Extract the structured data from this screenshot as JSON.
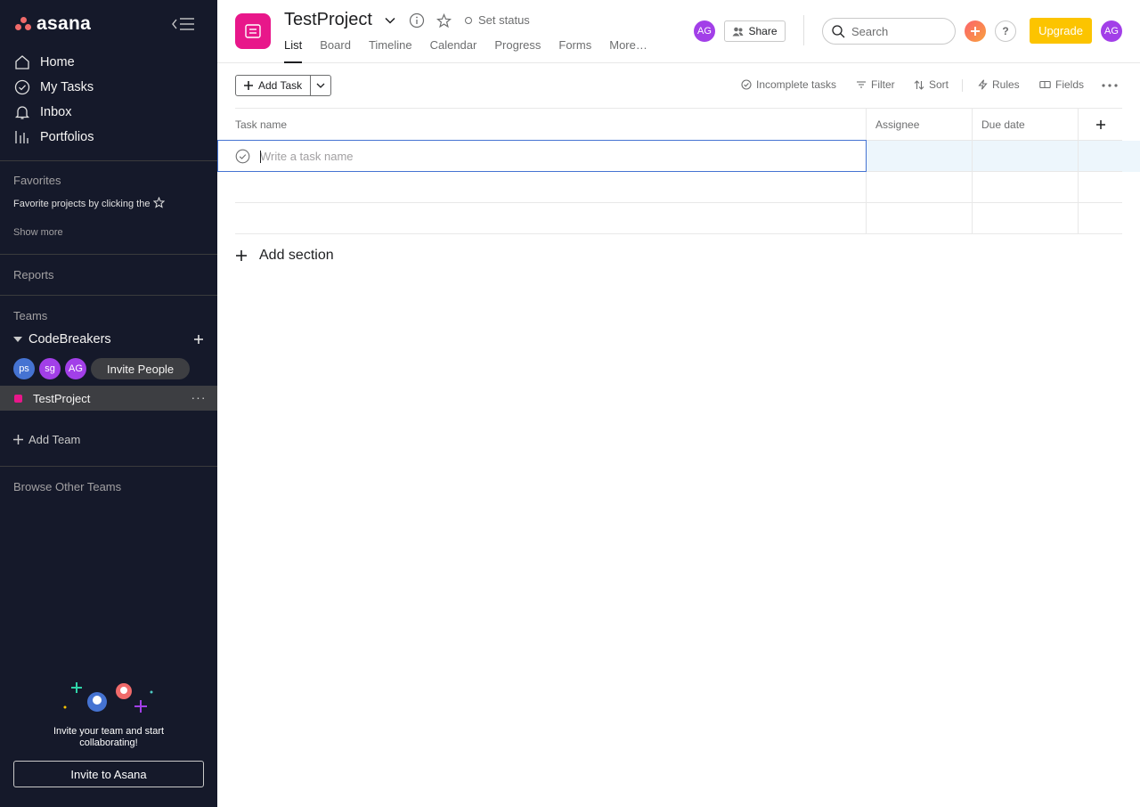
{
  "sidebar": {
    "logo_text": "asana",
    "nav": [
      {
        "label": "Home",
        "icon": "home-icon"
      },
      {
        "label": "My Tasks",
        "icon": "check-circle-icon"
      },
      {
        "label": "Inbox",
        "icon": "bell-icon"
      },
      {
        "label": "Portfolios",
        "icon": "bar-chart-icon"
      }
    ],
    "favorites_title": "Favorites",
    "favorites_hint": "Favorite projects by clicking the",
    "show_more": "Show more",
    "reports": "Reports",
    "teams_title": "Teams",
    "team_name": "CodeBreakers",
    "members": [
      {
        "initials": "ps",
        "color": "#4573d2"
      },
      {
        "initials": "sg",
        "color": "#a23fe8"
      },
      {
        "initials": "AG",
        "color": "#a23fe8"
      }
    ],
    "invite_people": "Invite People",
    "project_name": "TestProject",
    "project_more": "···",
    "add_team": "Add Team",
    "browse_teams": "Browse Other Teams",
    "invite_text": "Invite your team and start collaborating!",
    "invite_button": "Invite to Asana"
  },
  "header": {
    "project_title": "TestProject",
    "set_status": "Set status",
    "tabs": [
      "List",
      "Board",
      "Timeline",
      "Calendar",
      "Progress",
      "Forms",
      "More…"
    ],
    "active_tab": "List",
    "member_avatar": "AG",
    "share": "Share",
    "search_placeholder": "Search",
    "help": "?",
    "upgrade": "Upgrade",
    "user_avatar": "AG"
  },
  "toolbar": {
    "add_task": "Add Task",
    "incomplete": "Incomplete tasks",
    "filter": "Filter",
    "sort": "Sort",
    "rules": "Rules",
    "fields": "Fields"
  },
  "table": {
    "columns": [
      "Task name",
      "Assignee",
      "Due date"
    ],
    "new_task_placeholder": "Write a task name",
    "add_section": "Add section"
  },
  "colors": {
    "sidebar_bg": "#15192a",
    "project_pink": "#e8178a",
    "upgrade_yellow": "#fcc400",
    "avatar_purple": "#a23fe8",
    "focus_blue": "#4573d2"
  }
}
